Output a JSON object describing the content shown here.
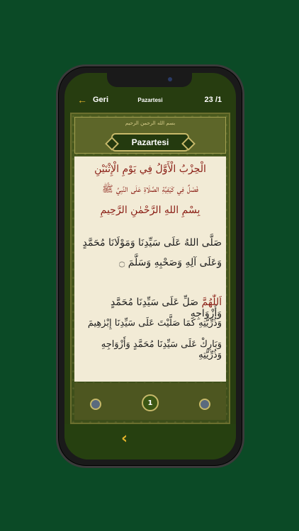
{
  "nav": {
    "back_label": "Geri",
    "title": "Pazartesi",
    "page_counter": "23 /1"
  },
  "header": {
    "calligraphy": "بسم الله الرحمن الرحيم",
    "day_title": "Pazartesi"
  },
  "content": {
    "heading_line1": "الْحِزْبُ الْأَوَّلُ فِي يَوْمِ الْإِثْنَيْنِ",
    "heading_line2": "فَصْلٌ فِي كَيْفِيَّةِ الصَّلَاةِ عَلَى النَّبِيِّ ﷺ",
    "heading_line3": "بِسْمِ اللهِ الرَّحْمٰنِ الرَّحِيمِ",
    "para1_line1": "صَلَّى اللهُ عَلَى سَيِّدِنَا وَمَوْلَانَا مُحَمَّدٍ",
    "para1_line2": "وَعَلَى آلِهِ وَصَحْبِهِ وَسَلَّمَ ۝",
    "para2_line1_red": "اَللّٰهُمَّ",
    "para2_line1_rest": "صَلِّ عَلَى سَيِّدِنَا مُحَمَّدٍ وَأَزْوَاجِهِ",
    "para2_line2": "وَذُرِّيَّتِهِ كَمَا صَلَّيْتَ عَلَى سَيِّدِنَا إِبْرٰهِيمَ",
    "para2_line3": "وَبَارِكْ عَلَى سَيِّدِنَا مُحَمَّدٍ وَأَزْوَاجِهِ وَذُرِّيَّتِهِ"
  },
  "footer": {
    "page_number": "1"
  },
  "bottom": {
    "prev_icon": "chevron-left-icon"
  },
  "colors": {
    "background": "#0b4a26",
    "accent": "#e2b32a",
    "heading_red": "#8a1e15"
  }
}
